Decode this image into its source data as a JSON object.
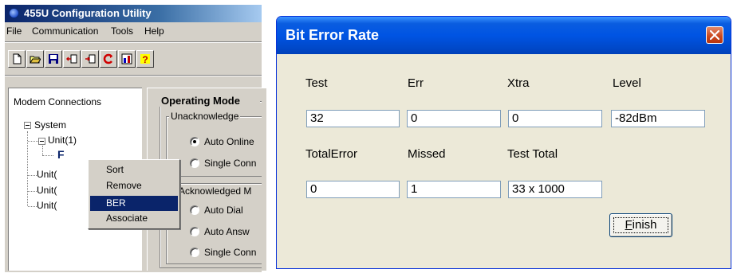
{
  "app": {
    "title": "455U Configuration Utility",
    "menu": [
      "File",
      "Communication",
      "Tools",
      "Help"
    ],
    "toolbar_icons": [
      "new-file-icon",
      "open-folder-icon",
      "save-icon",
      "upload-icon",
      "download-icon",
      "refresh-icon",
      "chart-icon",
      "help-icon"
    ]
  },
  "connections": {
    "label": "Modem Connections",
    "tree": {
      "system": "System",
      "unit1": "Unit(1)",
      "unit_child_glyph": "F",
      "units": [
        "Unit(",
        "Unit(",
        "Unit("
      ]
    }
  },
  "operating_mode": {
    "title": "Operating Mode",
    "unack_group": "Unacknowledge",
    "ack_group": "Acknowledged M",
    "options": {
      "auto_online": "Auto Online",
      "single_conn_1": "Single Conn",
      "auto_dial": "Auto Dial",
      "auto_answer": "Auto Answ",
      "single_conn_2": "Single Conn"
    }
  },
  "context_menu": {
    "items": [
      "Sort",
      "Remove",
      "BER",
      "Associate"
    ],
    "selected_index": 2
  },
  "ber_dialog": {
    "title": "Bit Error Rate",
    "labels": {
      "test": "Test",
      "err": "Err",
      "xtra": "Xtra",
      "level": "Level",
      "total_error": "TotalError",
      "missed": "Missed",
      "test_total": "Test Total"
    },
    "values": {
      "test": "32",
      "err": "0",
      "xtra": "0",
      "level": "-82dBm",
      "total_error": "0",
      "missed": "1",
      "test_total": "33 x 1000"
    },
    "finish_label": "Finish"
  },
  "colors": {
    "classic_title": "#0a246a",
    "xp_title": "#0054e3",
    "close_button": "#c9461c",
    "menu_highlight": "#0a246a"
  }
}
